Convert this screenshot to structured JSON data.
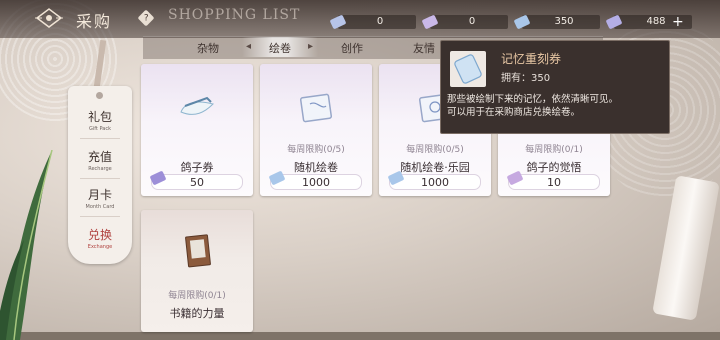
{
  "header": {
    "title": "采购",
    "help_label": "?",
    "subtitle": "SHOPPING LIST",
    "currencies": [
      {
        "icon": "ticket-icon",
        "value": "0"
      },
      {
        "icon": "ticket-icon",
        "value": "0"
      },
      {
        "icon": "ticket-icon",
        "value": "350"
      },
      {
        "icon": "ticket-icon",
        "value": "488"
      }
    ],
    "plus_label": "+"
  },
  "tabs": [
    {
      "label": "杂物"
    },
    {
      "label": "绘卷",
      "active": true
    },
    {
      "label": "创作"
    },
    {
      "label": "友情"
    }
  ],
  "sidenav": [
    {
      "zh": "礼包",
      "en": "Gift Pack"
    },
    {
      "zh": "充值",
      "en": "Recharge"
    },
    {
      "zh": "月卡",
      "en": "Month Card"
    },
    {
      "zh": "兑换",
      "en": "Exchange",
      "active": true
    }
  ],
  "cards": [
    {
      "name": "鸽子券",
      "limit": "",
      "price": "50"
    },
    {
      "name": "随机绘卷",
      "limit": "每周限购(0/5)",
      "price": "1000"
    },
    {
      "name": "随机绘卷·乐园",
      "limit": "每周限购(0/5)",
      "price": "1000"
    },
    {
      "name": "鸽子的觉悟",
      "limit": "每周限购(0/1)",
      "price": "10"
    },
    {
      "name": "书籍的力量",
      "limit": "每周限购(0/1)",
      "price": ""
    }
  ],
  "tooltip": {
    "name": "记忆重刻券",
    "owned": "拥有：350",
    "desc_line1": "那些被绘制下来的记忆，依然清晰可见。",
    "desc_line2": "可以用于在采购商店兑换绘卷。"
  },
  "colors": {
    "header_bg": "#3a2e2b",
    "accent_red": "#b0423f",
    "tooltip_bg": "#3a302d",
    "tooltip_title": "#e9c8a5",
    "card_lavender": "#ebe2f1"
  }
}
